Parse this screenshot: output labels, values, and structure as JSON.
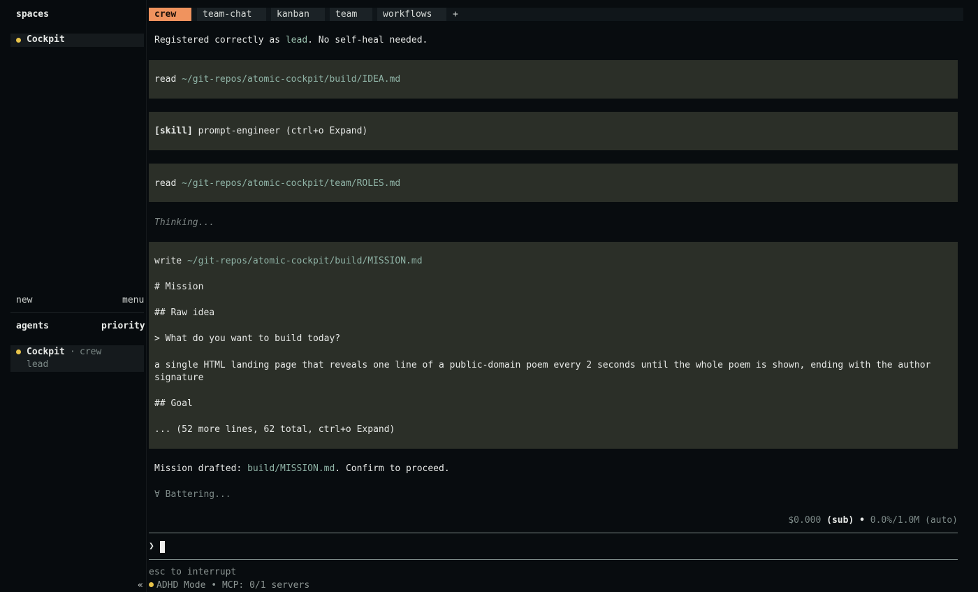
{
  "sidebar": {
    "spaces_header": "spaces",
    "spaces": [
      {
        "label": "Cockpit"
      }
    ],
    "new_label": "new",
    "menu_label": "menu",
    "agents_header": "agents",
    "priority_label": "priority",
    "agents": [
      {
        "name": "Cockpit",
        "sep": "·",
        "team": "crew",
        "role": "lead"
      }
    ],
    "collapse_glyph": "«"
  },
  "tabs": [
    {
      "label": "crew",
      "active": true
    },
    {
      "label": "team-chat"
    },
    {
      "label": "kanban"
    },
    {
      "label": "team"
    },
    {
      "label": "workflows"
    }
  ],
  "tab_add": "+",
  "transcript": {
    "reg_pre": "Registered correctly as ",
    "reg_role": "lead",
    "reg_post": ". No self-heal needed.",
    "read1_cmd": "read",
    "read1_path": "~/git-repos/atomic-cockpit/build/IDEA.md",
    "skill_tag": "[skill]",
    "skill_text": "prompt-engineer (ctrl+o Expand)",
    "read2_cmd": "read",
    "read2_path": "~/git-repos/atomic-cockpit/team/ROLES.md",
    "thinking": "Thinking...",
    "write_cmd": "write",
    "write_path": "~/git-repos/atomic-cockpit/build/MISSION.md",
    "write_lines": [
      "# Mission",
      "## Raw idea",
      "> What do you want to build today?",
      "a single HTML landing page that reveals one line of a public-domain poem every 2 seconds until the whole poem is shown, ending with the author",
      "signature",
      "## Goal",
      "... (52 more lines, 62 total, ctrl+o Expand)"
    ],
    "mission_pre": "Mission drafted: ",
    "mission_file": "build/MISSION.md",
    "mission_post": ". Confirm to proceed.",
    "battering": "∀ Battering..."
  },
  "status": {
    "cost": "$0.000",
    "plan": "(sub)",
    "bullet": "•",
    "context": "0.0%/1.0M (auto)"
  },
  "prompt": {
    "glyph": "❯",
    "value": ""
  },
  "footer": {
    "hint": "esc to interrupt",
    "mode": "ADHD Mode",
    "bullet": "•",
    "mcp": "MCP: 0/1 servers"
  },
  "colors": {
    "accent": "#f0935e",
    "status_dot": "#e8c34a",
    "block_bg": "#2b2f28",
    "path": "#8fb3a6"
  }
}
